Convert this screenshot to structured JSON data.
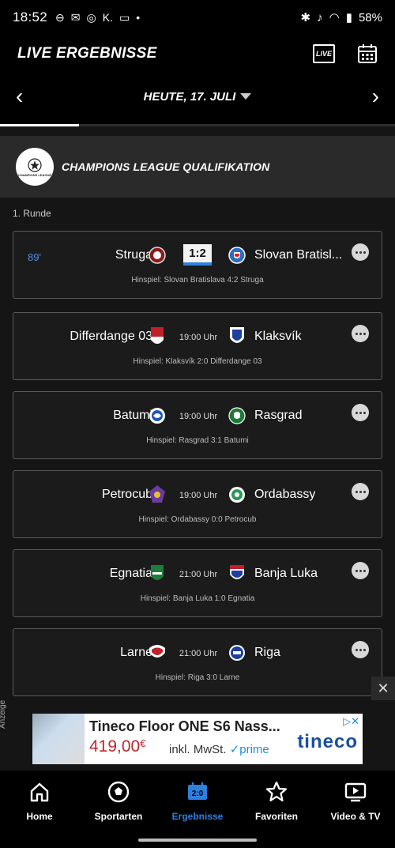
{
  "status": {
    "time": "18:52",
    "battery": "58%"
  },
  "header": {
    "title": "LIVE ERGEBNISSE",
    "live_label": "LIVE"
  },
  "datebar": {
    "date": "HEUTE, 17. JULI"
  },
  "league": {
    "name": "CHAMPIONS LEAGUE QUALIFIKATION",
    "logo_text": "CHAMPIONS LEAGUE"
  },
  "round": "1. Runde",
  "matches": [
    {
      "minute": "89'",
      "home": "Struga",
      "away": "Slovan Bratisl...",
      "score": "1:2",
      "first_leg": "Hinspiel: Slovan Bratislava 4:2 Struga"
    },
    {
      "home": "Differdange 03",
      "away": "Klaksvík",
      "kickoff": "19:00 Uhr",
      "first_leg": "Hinspiel: Klaksvík 2:0 Differdange 03"
    },
    {
      "home": "Batumi",
      "away": "Rasgrad",
      "kickoff": "19:00 Uhr",
      "first_leg": "Hinspiel: Rasgrad 3:1 Batumi"
    },
    {
      "home": "Petrocub",
      "away": "Ordabassy",
      "kickoff": "19:00 Uhr",
      "first_leg": "Hinspiel: Ordabassy 0:0 Petrocub"
    },
    {
      "home": "Egnatia",
      "away": "Banja Luka",
      "kickoff": "21:00 Uhr",
      "first_leg": "Hinspiel: Banja Luka 1:0 Egnatia"
    },
    {
      "home": "Larne",
      "away": "Riga",
      "kickoff": "21:00 Uhr",
      "first_leg": "Hinspiel: Riga 3:0 Larne"
    }
  ],
  "ad": {
    "label": "Anzeige",
    "headline": "Tineco Floor ONE S6 Nass...",
    "price": "419,00",
    "currency": "€",
    "tax_note": "inkl. MwSt.",
    "prime": "prime",
    "brand": "tineco"
  },
  "nav": [
    {
      "label": "Home",
      "icon": "home-icon"
    },
    {
      "label": "Sportarten",
      "icon": "soccer-ball-icon"
    },
    {
      "label": "Ergebnisse",
      "icon": "scoreboard-icon",
      "active": true
    },
    {
      "label": "Favoriten",
      "icon": "star-icon"
    },
    {
      "label": "Video & TV",
      "icon": "play-screen-icon"
    }
  ],
  "colors": {
    "accent": "#2e7fe0",
    "live_minute": "#4a90e2",
    "background": "#151515"
  }
}
